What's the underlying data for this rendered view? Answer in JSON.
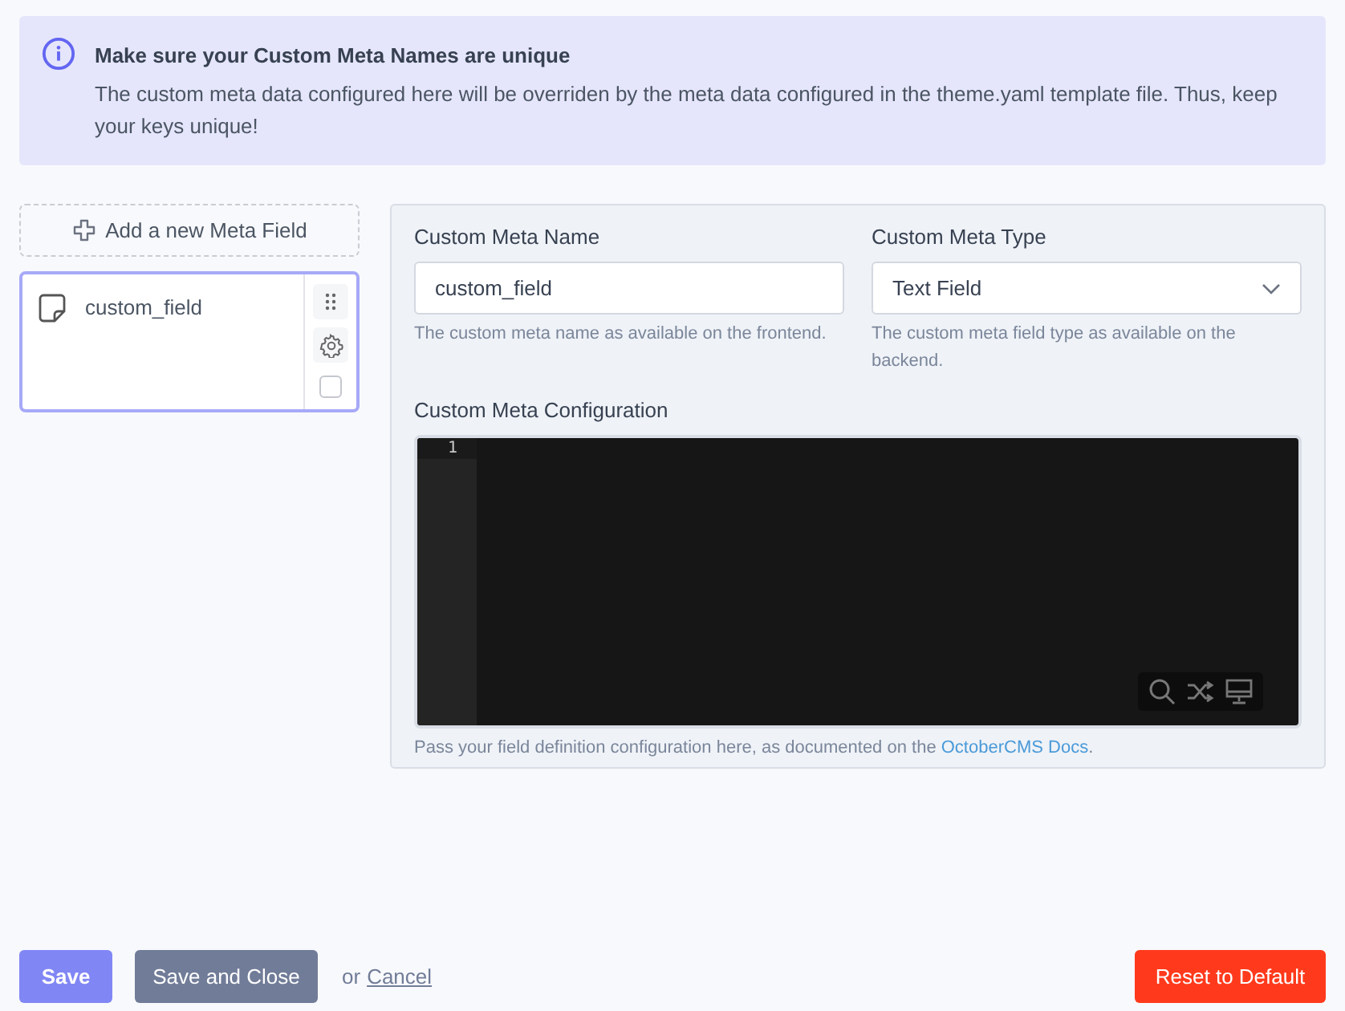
{
  "alert": {
    "title": "Make sure your Custom Meta Names are unique",
    "message": "The custom meta data configured here will be overriden by the meta data configured in the theme.yaml template file. Thus, keep your keys unique!"
  },
  "field_list": {
    "add_button": "Add a new Meta Field",
    "items": [
      {
        "name": "custom_field",
        "selected": true,
        "checked": false
      }
    ]
  },
  "form": {
    "name": {
      "label": "Custom Meta Name",
      "value": "custom_field",
      "hint": "The custom meta name as available on the frontend."
    },
    "type": {
      "label": "Custom Meta Type",
      "value": "Text Field",
      "hint": "The custom meta field type as available on the backend."
    },
    "configuration": {
      "label": "Custom Meta Configuration",
      "line_numbers": [
        "1"
      ],
      "hint_before": "Pass your field definition configuration here, as documented on the ",
      "link": "OctoberCMS Docs",
      "hint_after": "."
    }
  },
  "footer": {
    "save": "Save",
    "save_close": "Save and Close",
    "or": "or",
    "cancel": "Cancel",
    "reset": "Reset to Default"
  }
}
